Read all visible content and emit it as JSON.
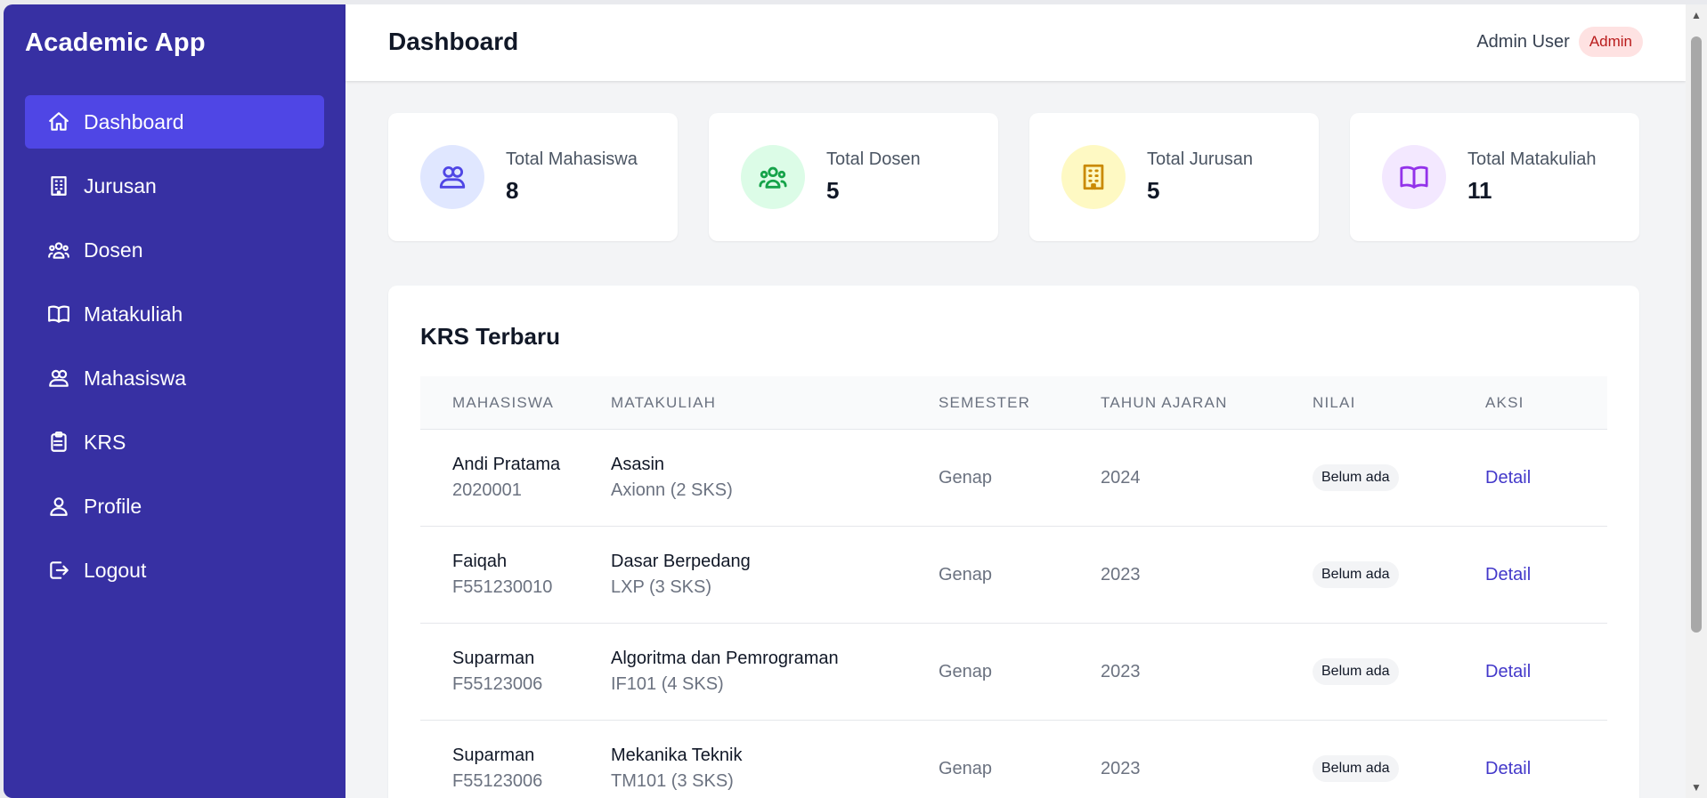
{
  "app": {
    "title": "Academic App"
  },
  "sidebar": {
    "items": [
      {
        "label": "Dashboard",
        "icon": "home-icon",
        "active": true
      },
      {
        "label": "Jurusan",
        "icon": "building-icon"
      },
      {
        "label": "Dosen",
        "icon": "users-group-icon"
      },
      {
        "label": "Matakuliah",
        "icon": "book-open-icon"
      },
      {
        "label": "Mahasiswa",
        "icon": "users-icon"
      },
      {
        "label": "KRS",
        "icon": "clipboard-list-icon"
      },
      {
        "label": "Profile",
        "icon": "user-icon"
      },
      {
        "label": "Logout",
        "icon": "logout-icon"
      }
    ]
  },
  "header": {
    "title": "Dashboard",
    "user_name": "Admin User",
    "role": "Admin"
  },
  "stats": [
    {
      "label": "Total Mahasiswa",
      "value": "8",
      "icon": "users-icon",
      "color": "#4f46e5",
      "bg": "#e0e7ff"
    },
    {
      "label": "Total Dosen",
      "value": "5",
      "icon": "users-group-icon",
      "color": "#16a34a",
      "bg": "#dcfce7"
    },
    {
      "label": "Total Jurusan",
      "value": "5",
      "icon": "building-icon",
      "color": "#ca8a04",
      "bg": "#fef9c3"
    },
    {
      "label": "Total Matakuliah",
      "value": "11",
      "icon": "book-open-icon",
      "color": "#9333ea",
      "bg": "#f3e8ff"
    }
  ],
  "krs": {
    "title": "KRS Terbaru",
    "columns": [
      "Mahasiswa",
      "Matakuliah",
      "Semester",
      "Tahun Ajaran",
      "Nilai",
      "Aksi"
    ],
    "rows": [
      {
        "name": "Andi Pratama",
        "nim": "2020001",
        "course": "Asasin",
        "course_detail": "Axionn (2 SKS)",
        "semester": "Genap",
        "year": "2024",
        "grade": "Belum ada",
        "action": "Detail"
      },
      {
        "name": "Faiqah",
        "nim": "F551230010",
        "course": "Dasar Berpedang",
        "course_detail": "LXP (3 SKS)",
        "semester": "Genap",
        "year": "2023",
        "grade": "Belum ada",
        "action": "Detail"
      },
      {
        "name": "Suparman",
        "nim": "F55123006",
        "course": "Algoritma dan Pemrograman",
        "course_detail": "IF101 (4 SKS)",
        "semester": "Genap",
        "year": "2023",
        "grade": "Belum ada",
        "action": "Detail"
      },
      {
        "name": "Suparman",
        "nim": "F55123006",
        "course": "Mekanika Teknik",
        "course_detail": "TM101 (3 SKS)",
        "semester": "Genap",
        "year": "2023",
        "grade": "Belum ada",
        "action": "Detail"
      }
    ]
  },
  "colors": {
    "sidebar": "#3730a3",
    "active_item": "#4f46e5",
    "link": "#4338ca",
    "badge_bg": "#fee2e2",
    "badge_text": "#b91c1c"
  }
}
